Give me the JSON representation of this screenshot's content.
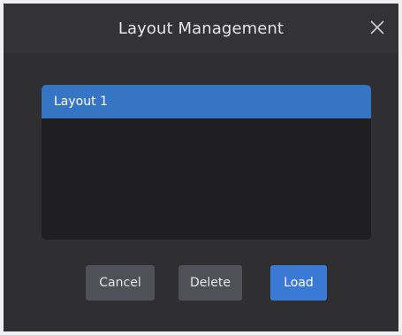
{
  "dialog": {
    "title": "Layout Management",
    "close_icon": "close-icon"
  },
  "layouts": {
    "items": [
      {
        "label": "Layout 1",
        "selected": true
      }
    ]
  },
  "buttons": {
    "cancel_label": "Cancel",
    "delete_label": "Delete",
    "load_label": "Load"
  },
  "colors": {
    "accent": "#3a7ad4",
    "selection": "#3575c4",
    "dialog_bg": "#2f2f31",
    "list_bg": "#1f1f21",
    "secondary_button": "#505058"
  }
}
